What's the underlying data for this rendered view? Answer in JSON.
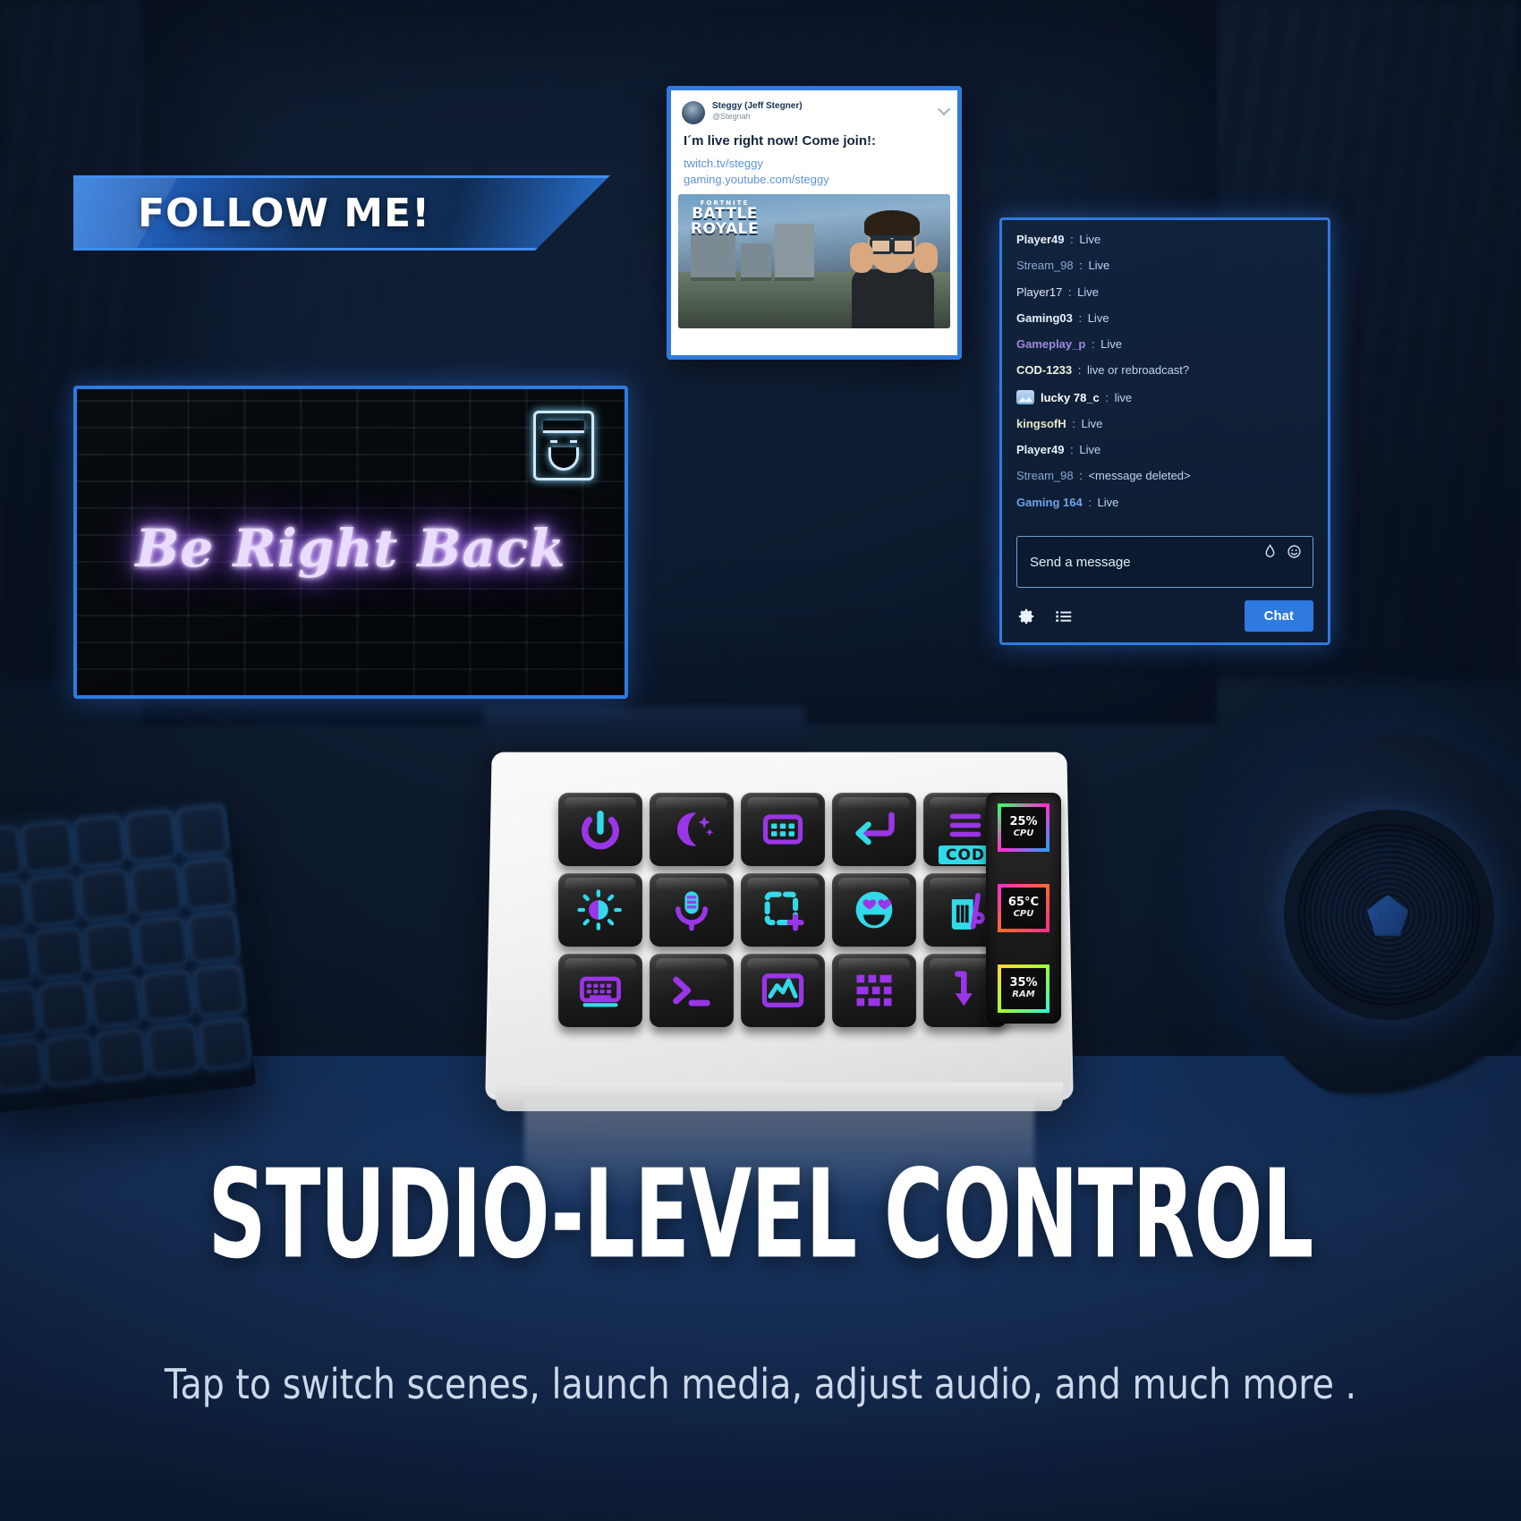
{
  "banner": {
    "label": "FOLLOW ME!"
  },
  "tweet": {
    "display_name": "Steggy (Jeff Stegner)",
    "handle": "@Stegnah",
    "message": "I´m live right now! Come join!:",
    "link1": "twitch.tv/steggy",
    "link2": "gaming.youtube.com/steggy",
    "media_logo_top": "FORTNITE",
    "media_logo_line1": "BATTLE",
    "media_logo_line2": "ROYALE",
    "caret_icon": "chevron-down-icon",
    "avatar_icon": "avatar"
  },
  "chat": {
    "messages": [
      {
        "user": "Player49",
        "sep": ":",
        "text": "Live",
        "badge": false,
        "user_color": "#e8f1fd",
        "bold": true
      },
      {
        "user": "Stream_98",
        "sep": ":",
        "text": "Live",
        "badge": false,
        "user_color": "#8aa9d8",
        "bold": false
      },
      {
        "user": "Player17",
        "sep": ":",
        "text": "Live",
        "badge": false,
        "user_color": "#dfe9f7",
        "bold": false
      },
      {
        "user": "Gaming03",
        "sep": ":",
        "text": "Live",
        "badge": false,
        "user_color": "#e8f1fd",
        "bold": true
      },
      {
        "user": "Gameplay_p",
        "sep": ":",
        "text": "Live",
        "badge": false,
        "user_color": "#9f8ae0",
        "bold": true
      },
      {
        "user": "COD-1233",
        "sep": ":",
        "text": "live or rebroadcast?",
        "badge": false,
        "user_color": "#f2f2e2",
        "bold": true
      },
      {
        "user": "lucky 78_c",
        "sep": ":",
        "text": "live",
        "badge": true,
        "user_color": "#ffffff",
        "bold": true
      },
      {
        "user": "kingsofH",
        "sep": ":",
        "text": "Live",
        "badge": false,
        "user_color": "#e6e6c8",
        "bold": true
      },
      {
        "user": "Player49",
        "sep": ":",
        "text": "Live",
        "badge": false,
        "user_color": "#e8f1fd",
        "bold": true
      },
      {
        "user": "Stream_98",
        "sep": ":",
        "text": "<message deleted>",
        "badge": false,
        "user_color": "#8aa9d8",
        "bold": false
      },
      {
        "user": "Gaming 164",
        "sep": ":",
        "text": "Live",
        "badge": false,
        "user_color": "#6fa4e8",
        "bold": true
      }
    ],
    "input_placeholder": "Send a message",
    "input_icon_1": "bits-icon",
    "input_icon_2": "emoji-icon",
    "gear_icon": "gear-icon",
    "list_icon": "list-icon",
    "send_button_label": "Chat",
    "accent_color": "#2f7ae0"
  },
  "brb": {
    "neon_text": "Be Right Back",
    "face_icon": "bearded-face-icon",
    "neon_color": "#c08cff"
  },
  "keypad": {
    "keys": [
      {
        "icon": "power-icon",
        "label": ""
      },
      {
        "icon": "moon-sparkle-icon",
        "label": ""
      },
      {
        "icon": "keypad-grid-icon",
        "label": ""
      },
      {
        "icon": "return-arrow-icon",
        "label": ""
      },
      {
        "icon": "menu-lines-icon",
        "label": "COD"
      },
      {
        "icon": "brightness-icon",
        "label": ""
      },
      {
        "icon": "microphone-icon",
        "label": ""
      },
      {
        "icon": "screenshot-add-icon",
        "label": ""
      },
      {
        "icon": "heart-eyes-emoji-icon",
        "label": ""
      },
      {
        "icon": "trash-icon",
        "label": ""
      },
      {
        "icon": "keyboard-icon",
        "label": ""
      },
      {
        "icon": "terminal-icon",
        "label": ""
      },
      {
        "icon": "chart-monitor-icon",
        "label": ""
      },
      {
        "icon": "pixel-grid-icon",
        "label": ""
      },
      {
        "icon": "download-arrow-icon",
        "label": ""
      }
    ],
    "status_strip": [
      {
        "value": "25%",
        "label": "CPU"
      },
      {
        "value": "65°C",
        "label": "CPU"
      },
      {
        "value": "35%",
        "label": "RAM"
      }
    ]
  },
  "footer": {
    "headline": "STUDIO-LEVEL CONTROL",
    "subhead": "Tap to switch scenes, launch media, adjust audio, and much more ."
  }
}
